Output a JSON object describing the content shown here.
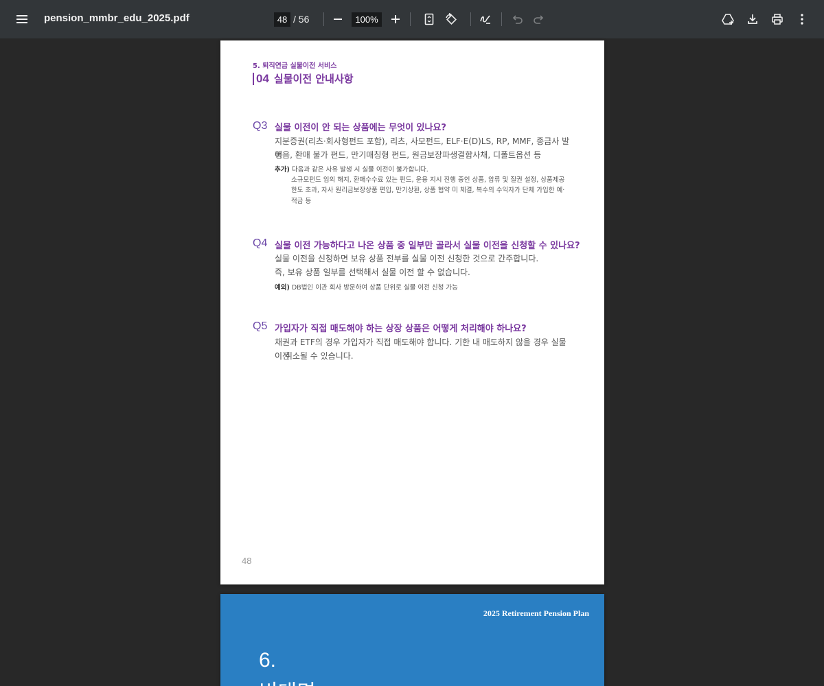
{
  "toolbar": {
    "filename": "pension_mmbr_edu_2025.pdf",
    "current_page": "48",
    "total_pages": "/ 56",
    "zoom": "100%"
  },
  "page1": {
    "section_kicker": "5. 퇴직연금 실물이전 서비스",
    "section_num": "04",
    "section_title": "실물이전 안내사항",
    "q3": {
      "label": "Q3",
      "title": "실물 이전이 안 되는 상품에는 무엇이 있나요?",
      "answer_line1": "지분증권(리츠·회사형펀드 포함), 리츠, 사모펀드, ELF·E(D)LS, RP, MMF, 종금사 발행",
      "answer_line2": "어음, 환매 불가 펀드, 만기매칭형 펀드, 원금보장파생결합사채, 디폴트옵션 등",
      "note_tag": "추가)",
      "note_intro": "다음과 같은 사유 발생 시 실물 이전이 불가합니다.",
      "note_line1": "소규모펀드 임의 해지, 환매수수료 있는 펀드, 운용 지시 진행 중인 상품, 압류 및 질권 설정, 상품제공",
      "note_line2": "한도 초과, 자사 원리금보장상품 편입, 만기상환, 상품 협약 미 체결, 복수의 수익자가 단체 가입한 예·",
      "note_line3": "적금 등"
    },
    "q4": {
      "label": "Q4",
      "title": "실물 이전 가능하다고 나온 상품 중 일부만 골라서 실물 이전을 신청할 수 있나요?",
      "answer_line1": "실물 이전을 신청하면 보유 상품 전부를 실물 이전 신청한 것으로 간주합니다.",
      "answer_line2": "즉, 보유 상품 일부를 선택해서 실물 이전 할 수 없습니다.",
      "note_tag": "예외)",
      "note_text": "DB법인 이관 회사 방문하여 상품 단위로 실물 이전 신청 가능"
    },
    "q5": {
      "label": "Q5",
      "title": "가입자가 직접 매도해야 하는 상장 상품은 어떻게 처리해야 하나요?",
      "answer_line1": "채권과 ETF의 경우 가입자가 직접 매도해야 합니다. 기한 내 매도하지 않을 경우 실물 이전",
      "answer_line2": "이 취소될 수 있습니다."
    },
    "page_number": "48"
  },
  "page2": {
    "header": "2025 Retirement Pension Plan",
    "chapter": "6.",
    "title": "비대면"
  },
  "colors": {
    "toolbar_bg": "#323639",
    "viewer_bg": "#282828",
    "accent_purple": "#7b3aa0",
    "page2_blue": "#2a7fc3"
  }
}
